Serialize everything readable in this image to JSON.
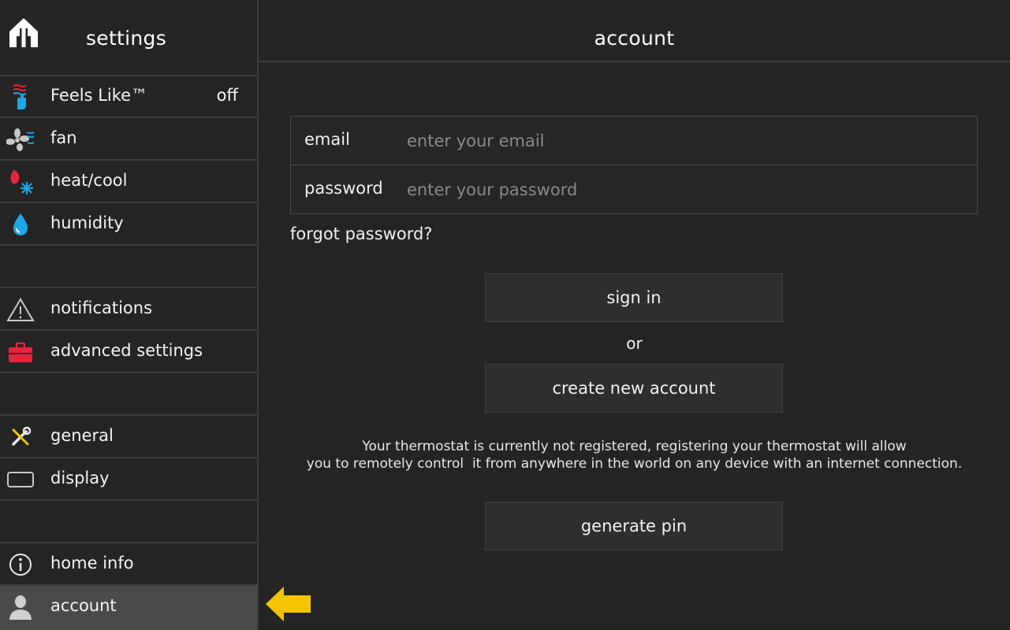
{
  "sidebar": {
    "title": "settings",
    "items": [
      {
        "label": "Feels Like™",
        "value": "off",
        "icon": "feels-like-icon"
      },
      {
        "label": "fan",
        "icon": "fan-icon"
      },
      {
        "label": "heat/cool",
        "icon": "heat-cool-icon"
      },
      {
        "label": "humidity",
        "icon": "humidity-icon"
      },
      {
        "label": "notifications",
        "icon": "warning-icon"
      },
      {
        "label": "advanced settings",
        "icon": "toolbox-icon"
      },
      {
        "label": "general",
        "icon": "tools-icon"
      },
      {
        "label": "display",
        "icon": "display-icon"
      },
      {
        "label": "home info",
        "icon": "info-icon"
      },
      {
        "label": "account",
        "icon": "user-icon",
        "active": true
      }
    ]
  },
  "main": {
    "title": "account",
    "email_label": "email",
    "email_placeholder": "enter your email",
    "password_label": "password",
    "password_placeholder": "enter your password",
    "forgot_password": "forgot password?",
    "sign_in": "sign in",
    "or": "or",
    "create_account": "create new account",
    "info_line1": "Your thermostat is currently not registered, registering your thermostat will allow",
    "info_line2": "you to remotely control  it from anywhere in the world on any device with an internet connection.",
    "generate_pin": "generate pin"
  },
  "colors": {
    "background": "#242424",
    "active_item": "#4a4a4a",
    "arrow": "#f5c400",
    "toolbox": "#e8233a",
    "humidity": "#1ea7e6"
  }
}
